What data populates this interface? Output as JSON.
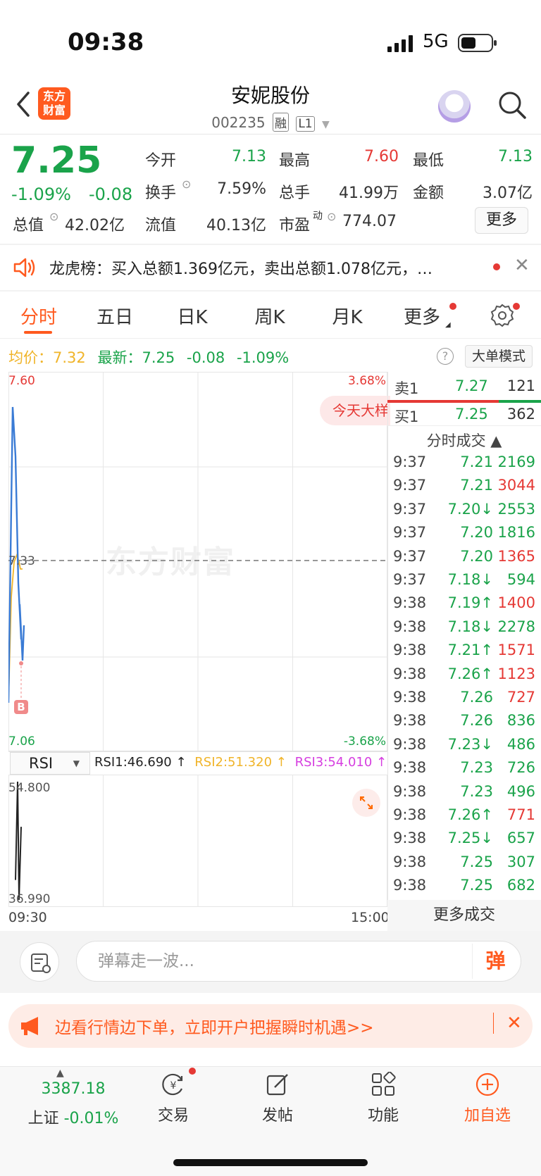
{
  "status": {
    "time": "09:38",
    "network": "5G"
  },
  "header": {
    "logo_line1": "东方",
    "logo_line2": "财富",
    "stock_name": "安妮股份",
    "stock_code": "002235",
    "tag_margin": "融",
    "tag_level": "L1"
  },
  "quote": {
    "price": "7.25",
    "pct": "-1.09%",
    "change": "-0.08",
    "open_label": "今开",
    "open": "7.13",
    "high_label": "最高",
    "high": "7.60",
    "low_label": "最低",
    "low": "7.13",
    "turnover_label": "换手",
    "turnover": "7.59%",
    "volume_label": "总手",
    "volume": "41.99万",
    "amount_label": "金额",
    "amount": "3.07亿",
    "mktcap_label": "总值",
    "mktcap": "42.02亿",
    "float_label": "流值",
    "float": "40.13亿",
    "pe_label": "市盈",
    "pe_sup": "动",
    "pe": "774.07",
    "more": "更多"
  },
  "news": {
    "text": "龙虎榜：买入总额1.369亿元，卖出总额1.078亿元，…"
  },
  "tabs": [
    {
      "label": "分时"
    },
    {
      "label": "五日"
    },
    {
      "label": "日K"
    },
    {
      "label": "周K"
    },
    {
      "label": "月K"
    },
    {
      "label": "更多"
    }
  ],
  "info_line": {
    "avg_label": "均价：",
    "avg": "7.32",
    "latest_label": "最新：",
    "latest": "7.25",
    "change": "-0.08",
    "pct": "-1.09%",
    "help": "?",
    "big_mode": "大单模式"
  },
  "chart_data": {
    "type": "line",
    "y_top": "7.60",
    "y_bottom": "7.06",
    "y_mid": "7.33",
    "pct_top": "3.68%",
    "pct_bottom": "-3.68%",
    "ylim": [
      7.06,
      7.6
    ],
    "x_start": "09:30",
    "x_end": "15:00",
    "series": [
      {
        "values": [
          7.13,
          7.55,
          7.48,
          7.3,
          7.22,
          7.27,
          7.19,
          7.24
        ]
      },
      {
        "values": [
          7.13,
          7.28,
          7.33,
          7.34,
          7.33,
          7.32,
          7.32
        ]
      }
    ],
    "badge": "今天大样",
    "watermark": "东方财富",
    "marker": "B",
    "rsi": {
      "label": "RSI",
      "rsi1": "RSI1:46.690 ↑",
      "rsi2": "RSI2:51.320 ↑",
      "rsi3": "RSI3:54.010 ↑",
      "top": "54.800",
      "bottom": "36.990",
      "values": [
        40,
        54.8,
        37,
        48
      ]
    },
    "colors": {
      "price": "#3a7bd5",
      "avg": "#f0b429",
      "rsi": "#222222"
    }
  },
  "orderbook": {
    "sell_label": "卖1",
    "sell_price": "7.27",
    "sell_vol": "121",
    "buy_label": "买1",
    "buy_price": "7.25",
    "buy_vol": "362",
    "trades_title": "分时成交 ▲",
    "more_trades": "更多成交"
  },
  "trades": [
    {
      "time": "9:37",
      "price": "7.21",
      "vol": "2169",
      "pc": "green",
      "vc": "green"
    },
    {
      "time": "9:37",
      "price": "7.21",
      "vol": "3044",
      "pc": "green",
      "vc": "red"
    },
    {
      "time": "9:37",
      "price": "7.20↓",
      "vol": "2553",
      "pc": "green",
      "vc": "green"
    },
    {
      "time": "9:37",
      "price": "7.20",
      "vol": "1816",
      "pc": "green",
      "vc": "green"
    },
    {
      "time": "9:37",
      "price": "7.20",
      "vol": "1365",
      "pc": "green",
      "vc": "red"
    },
    {
      "time": "9:37",
      "price": "7.18↓",
      "vol": "594",
      "pc": "green",
      "vc": "green"
    },
    {
      "time": "9:38",
      "price": "7.19↑",
      "vol": "1400",
      "pc": "green",
      "vc": "red"
    },
    {
      "time": "9:38",
      "price": "7.18↓",
      "vol": "2278",
      "pc": "green",
      "vc": "green"
    },
    {
      "time": "9:38",
      "price": "7.21↑",
      "vol": "1571",
      "pc": "green",
      "vc": "red"
    },
    {
      "time": "9:38",
      "price": "7.26↑",
      "vol": "1123",
      "pc": "green",
      "vc": "red"
    },
    {
      "time": "9:38",
      "price": "7.26",
      "vol": "727",
      "pc": "green",
      "vc": "red"
    },
    {
      "time": "9:38",
      "price": "7.26",
      "vol": "836",
      "pc": "green",
      "vc": "green"
    },
    {
      "time": "9:38",
      "price": "7.23↓",
      "vol": "486",
      "pc": "green",
      "vc": "green"
    },
    {
      "time": "9:38",
      "price": "7.23",
      "vol": "726",
      "pc": "green",
      "vc": "green"
    },
    {
      "time": "9:38",
      "price": "7.23",
      "vol": "496",
      "pc": "green",
      "vc": "green"
    },
    {
      "time": "9:38",
      "price": "7.26↑",
      "vol": "771",
      "pc": "green",
      "vc": "red"
    },
    {
      "time": "9:38",
      "price": "7.25↓",
      "vol": "657",
      "pc": "green",
      "vc": "green"
    },
    {
      "time": "9:38",
      "price": "7.25",
      "vol": "307",
      "pc": "green",
      "vc": "green"
    },
    {
      "time": "9:38",
      "price": "7.25",
      "vol": "682",
      "pc": "green",
      "vc": "green"
    }
  ],
  "comment": {
    "placeholder": "弹幕走一波...",
    "danmu": "弹"
  },
  "promo": {
    "text": "边看行情边下单，立即开户把握瞬时机遇>>",
    "close": "✕"
  },
  "bottom_nav": {
    "index_value": "3387.18",
    "index_name": "上证",
    "index_change": "-0.01%",
    "trade": "交易",
    "post": "发帖",
    "functions": "功能",
    "add_watch": "加自选"
  },
  "icons": [
    "back-icon",
    "search-icon",
    "speaker-icon",
    "close-icon",
    "gear-icon",
    "expand-icon",
    "comment-icon",
    "megaphone-icon",
    "yuan-icon",
    "edit-icon",
    "grid-icon",
    "plus-circle-icon"
  ]
}
